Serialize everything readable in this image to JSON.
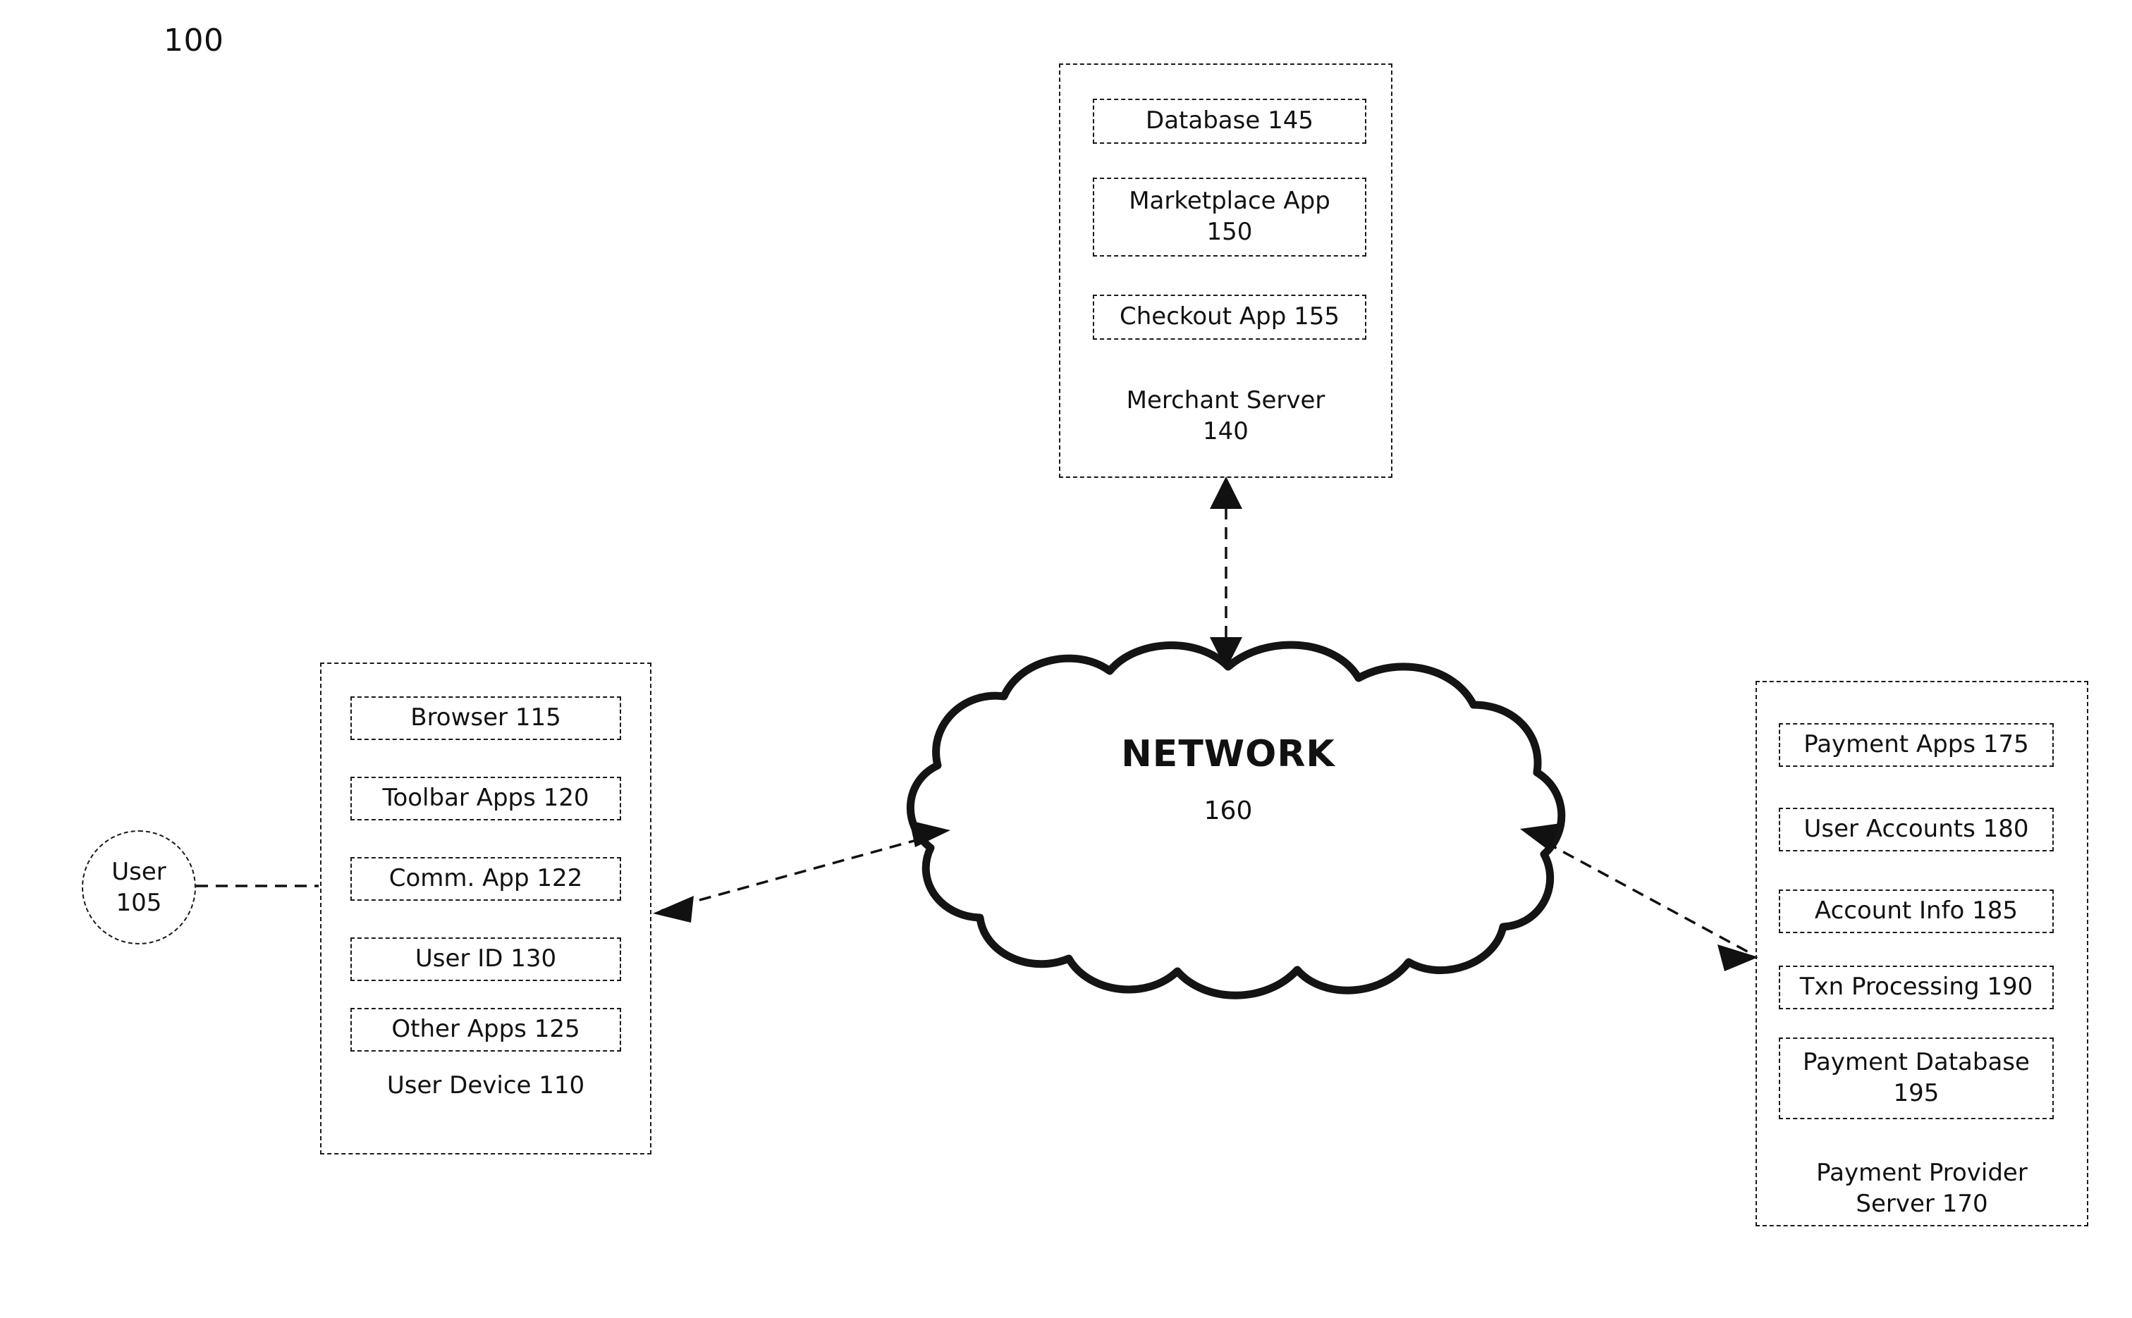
{
  "figure": {
    "number": "100",
    "accent_color": "#111111",
    "background_color": "#ffffff"
  },
  "actor": {
    "label": "User\n105"
  },
  "user_device": {
    "caption": "User Device 110",
    "components": [
      {
        "label": "Browser 115"
      },
      {
        "label": "Toolbar Apps 120"
      },
      {
        "label": "Comm. App 122"
      },
      {
        "label": "User ID 130"
      },
      {
        "label": "Other Apps 125"
      }
    ]
  },
  "merchant_server": {
    "caption": "Merchant Server\n140",
    "components": [
      {
        "label": "Database 145"
      },
      {
        "label": "Marketplace App\n150"
      },
      {
        "label": "Checkout App 155"
      }
    ]
  },
  "payment_provider_server": {
    "caption": "Payment Provider\nServer 170",
    "components": [
      {
        "label": "Payment Apps 175"
      },
      {
        "label": "User Accounts 180"
      },
      {
        "label": "Account Info 185"
      },
      {
        "label": "Txn Processing 190"
      },
      {
        "label": "Payment Database\n195"
      }
    ]
  },
  "network": {
    "title": "NETWORK",
    "reference": "160"
  },
  "connections": [
    {
      "from": "user",
      "to": "user-device",
      "style": "dashed",
      "arrows": "none"
    },
    {
      "from": "user-device",
      "to": "network",
      "style": "dashed",
      "arrows": "both"
    },
    {
      "from": "network",
      "to": "merchant-server",
      "style": "dashed",
      "arrows": "both"
    },
    {
      "from": "network",
      "to": "payment-provider-server",
      "style": "dashed",
      "arrows": "both"
    }
  ]
}
